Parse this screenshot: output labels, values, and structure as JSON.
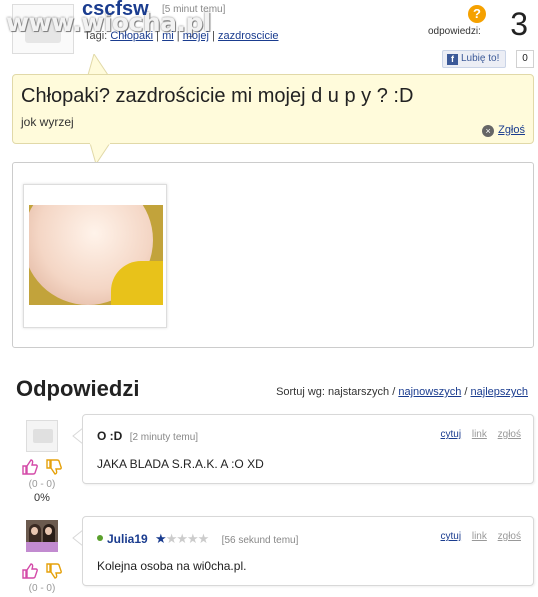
{
  "watermark": "www.wiocha.pl",
  "question": {
    "author": "cscfsw",
    "time_ago": "[5 minut temu]",
    "tags_label": "Tagi:",
    "tags": [
      "Chłopaki",
      "mi",
      "mojej",
      "zazdroscicie"
    ],
    "answers_label": "odpowiedzi:",
    "answers_count": "3",
    "badge": "?",
    "like_label": "Lubię to!",
    "like_count": "0",
    "title": "Chłopaki? zazdrościcie mi mojej d u p y ? :D",
    "body": "jok wyrzej",
    "report": "Zgłoś"
  },
  "responses": {
    "title": "Odpowiedzi",
    "sort_label": "Sortuj wg: najstarszych /",
    "sort_newest": "najnowszych",
    "sort_sep": "/",
    "sort_best": "najlepszych"
  },
  "replies": [
    {
      "author": "O :D",
      "time_ago": "[2 minuty temu]",
      "text": "JAKA BLADA S.R.A.K. A :O XD",
      "score": "(0 - 0)",
      "pct": "0%",
      "quote": "cytuj",
      "link": "link",
      "report": "zgłoś"
    },
    {
      "author": "Julia19",
      "time_ago": "[56 sekund temu]",
      "text": "Kolejna osoba na wi0cha.pl.",
      "score": "(0 - 0)",
      "rating": 1,
      "rating_max": 5,
      "quote": "cytuj",
      "link": "link",
      "report": "zgłoś"
    }
  ],
  "colors": {
    "link": "#1a3c8f",
    "question_bg": "#fffbdb",
    "badge": "#f5a100",
    "vote_up": "#d44aa8",
    "vote_down": "#e5a10b"
  }
}
